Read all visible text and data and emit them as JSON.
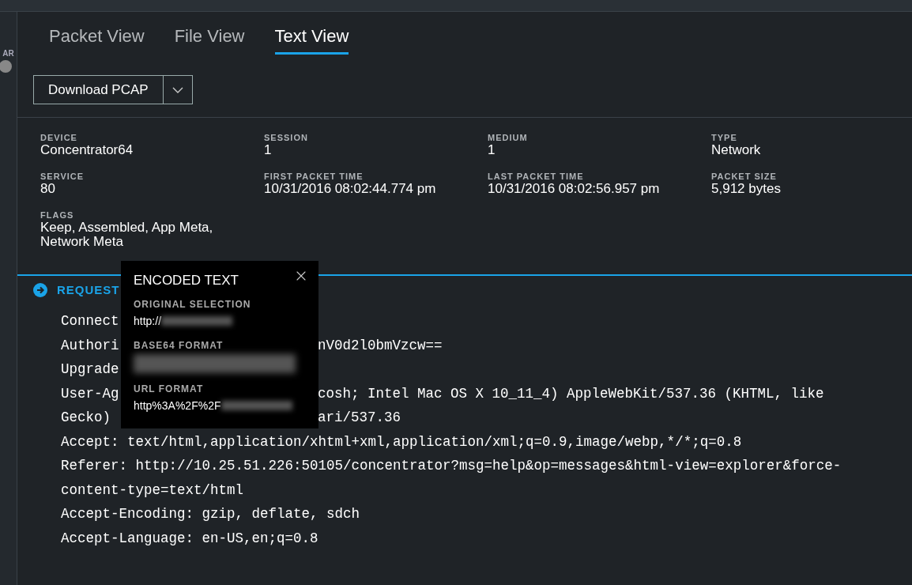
{
  "sidebar": {
    "label": "AR"
  },
  "tabs": [
    {
      "label": "Packet View",
      "selected": false
    },
    {
      "label": "File View",
      "selected": false
    },
    {
      "label": "Text View",
      "selected": true
    }
  ],
  "download_button": {
    "label": "Download PCAP"
  },
  "details": [
    {
      "label": "DEVICE",
      "value": "Concentrator64"
    },
    {
      "label": "SESSION",
      "value": "1"
    },
    {
      "label": "MEDIUM",
      "value": "1"
    },
    {
      "label": "TYPE",
      "value": "Network"
    },
    {
      "label": "SERVICE",
      "value": "80"
    },
    {
      "label": "FIRST PACKET TIME",
      "value": "10/31/2016 08:02:44.774 pm"
    },
    {
      "label": "LAST PACKET TIME",
      "value": "10/31/2016 08:02:56.957 pm"
    },
    {
      "label": "PACKET SIZE",
      "value": "5,912 bytes"
    },
    {
      "label": "FLAGS",
      "value": "Keep, Assembled, App Meta, Network Meta"
    }
  ],
  "section": {
    "title": "REQUEST"
  },
  "text_lines": [
    {
      "left": "Connect"
    },
    {
      "left": "Authori",
      "right": "nV0d2l0bmVzcw=="
    },
    {
      "left": "Upgrade"
    },
    {
      "left": "User-Ag",
      "right": "cosh; Intel Mac OS X 10_11_4) AppleWebKit/537.36 (KHTML, like"
    },
    {
      "left": "Gecko)",
      "right": "ari/537.36"
    },
    {
      "left": "Accept: text/html,application/xhtml+xml,application/xml;q=0.9,image/webp,*/*;q=0.8"
    },
    {
      "left": "Referer: http://10.25.51.226:50105/concentrator?msg=help&op=messages&html-view=explorer&force-"
    },
    {
      "left": "content-type=text/html"
    },
    {
      "left": "Accept-Encoding: gzip, deflate, sdch"
    },
    {
      "left": "Accept-Language: en-US,en;q=0.8"
    }
  ],
  "popup": {
    "title": "ENCODED TEXT",
    "fields": [
      {
        "label": "ORIGINAL SELECTION",
        "value": "http://",
        "redacted": true
      },
      {
        "label": "BASE64 FORMAT",
        "redacted": true
      },
      {
        "label": "URL FORMAT",
        "value": "http%3A%2F%2F",
        "redacted": true
      }
    ]
  }
}
